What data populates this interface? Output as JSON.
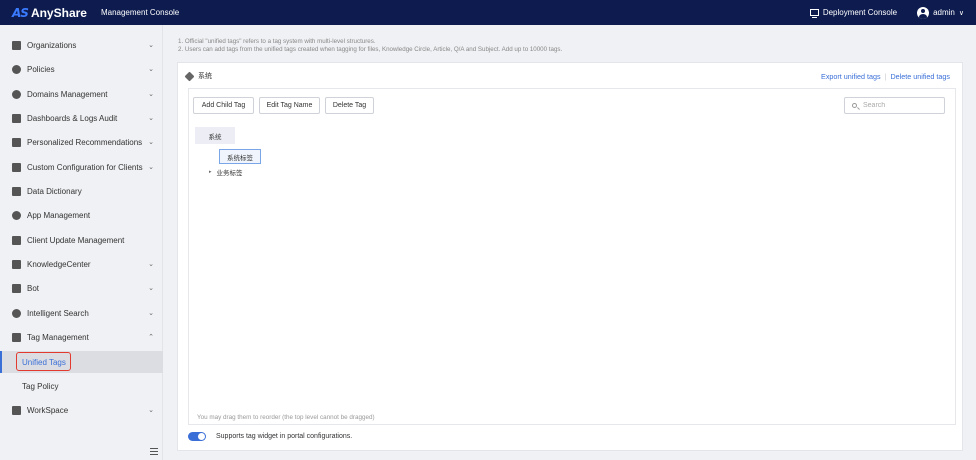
{
  "topbar": {
    "logo_mark": "AS",
    "logo_text": "AnyShare",
    "console_title": "Management Console",
    "deploy_label": "Deployment Console",
    "user_label": "admin",
    "chevron": "∨"
  },
  "sidebar": {
    "items": [
      {
        "label": "Organizations",
        "icon": "org-icon",
        "chevron": "⌄"
      },
      {
        "label": "Policies",
        "icon": "globe-icon",
        "chevron": "⌄"
      },
      {
        "label": "Domains Management",
        "icon": "domains-icon",
        "chevron": "⌄"
      },
      {
        "label": "Dashboards & Logs Audit",
        "icon": "chart-icon",
        "chevron": "⌄"
      },
      {
        "label": "Personalized Recommendations",
        "icon": "recommend-icon",
        "chevron": "⌄"
      },
      {
        "label": "Custom Configuration for Clients",
        "icon": "cube-icon",
        "chevron": "⌄"
      },
      {
        "label": "Data Dictionary",
        "icon": "dictionary-icon",
        "chevron": ""
      },
      {
        "label": "App Management",
        "icon": "app-icon",
        "chevron": ""
      },
      {
        "label": "Client Update Management",
        "icon": "update-icon",
        "chevron": ""
      },
      {
        "label": "KnowledgeCenter",
        "icon": "book-icon",
        "chevron": "⌄"
      },
      {
        "label": "Bot",
        "icon": "bot-icon",
        "chevron": "⌄"
      },
      {
        "label": "Intelligent Search",
        "icon": "search-icon",
        "chevron": "⌄"
      },
      {
        "label": "Tag Management",
        "icon": "tag-icon",
        "chevron": "⌃"
      }
    ],
    "sub_items": [
      {
        "label": "Unified Tags"
      },
      {
        "label": "Tag Policy"
      }
    ],
    "workspace": {
      "label": "WorkSpace",
      "icon": "grid-icon",
      "chevron": "⌄"
    }
  },
  "main": {
    "notes": [
      "1. Official \"unified tags\" refers to a tag system with multi-level structures.",
      "2. Users can add tags from the unified tags created when tagging for files, Knowledge Circle, Article, Q/A and Subject. Add up to 10000 tags."
    ],
    "panel_title": "系统",
    "export_link": "Export unified tags",
    "delete_link": "Delete unified tags",
    "buttons": {
      "add_child": "Add Child Tag",
      "edit_name": "Edit Tag Name",
      "delete": "Delete Tag"
    },
    "search_placeholder": "Search",
    "tree": {
      "root": "系统",
      "selected": "系统标签",
      "child": "业务标签",
      "caret": "▸"
    },
    "drag_hint": "You may drag them to reorder (the top level cannot be dragged)",
    "toggle_label": "Supports tag widget in portal configurations."
  }
}
